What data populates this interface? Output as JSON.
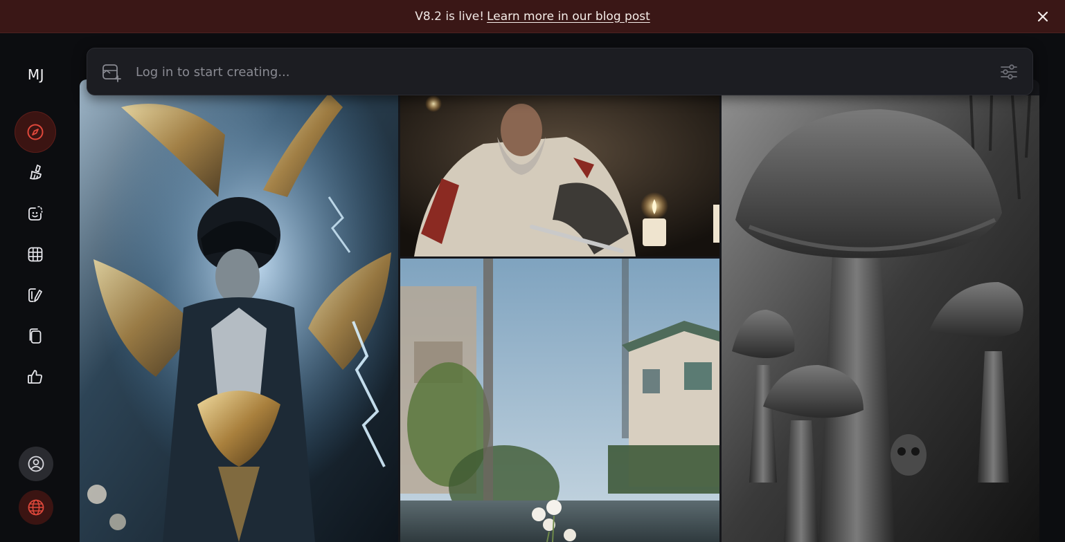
{
  "banner": {
    "message": "V8.2 is live!",
    "link_text": "Learn more in our blog post"
  },
  "sidebar": {
    "logo": "MJ",
    "items": [
      {
        "name": "explore",
        "icon": "compass-icon",
        "active": true
      },
      {
        "name": "create",
        "icon": "paintbrush-icon"
      },
      {
        "name": "edit",
        "icon": "smiley-edit-icon"
      },
      {
        "name": "organize",
        "icon": "grid-icon"
      },
      {
        "name": "personalize",
        "icon": "palette-edit-icon"
      },
      {
        "name": "moodboards",
        "icon": "copy-pages-icon"
      },
      {
        "name": "likes",
        "icon": "thumbs-up-icon"
      }
    ],
    "bottom": [
      {
        "name": "account",
        "icon": "user-circle-icon"
      },
      {
        "name": "language",
        "icon": "globe-icon"
      }
    ]
  },
  "prompt": {
    "placeholder": "Log in to start creating..."
  },
  "colors": {
    "accent": "#e0483b",
    "banner_bg": "#3a1716",
    "page_bg": "#0c0d10"
  },
  "gallery": {
    "tiles": [
      {
        "subject": "armored winged warrior with gold wings and blue lightning"
      },
      {
        "subject": "bearded templar knight sharpening a sword by candlelight"
      },
      {
        "subject": "blurred suburban street with white flowers in foreground"
      },
      {
        "subject": "giant grayscale mushrooms in a dark forest"
      }
    ]
  }
}
